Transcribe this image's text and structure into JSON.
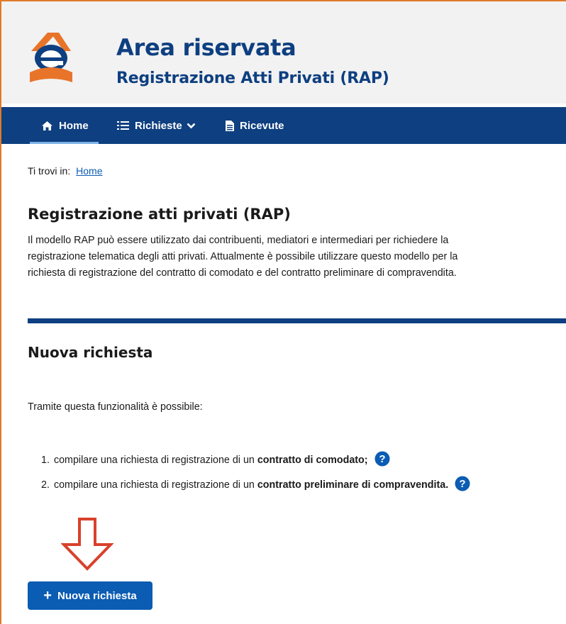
{
  "header": {
    "title": "Area riservata",
    "subtitle": "Registrazione Atti Privati (RAP)"
  },
  "nav": {
    "items": [
      {
        "label": "Home",
        "icon": "home-icon",
        "active": true
      },
      {
        "label": "Richieste",
        "icon": "list-icon",
        "dropdown": true
      },
      {
        "label": "Ricevute",
        "icon": "document-icon"
      }
    ]
  },
  "breadcrumb": {
    "prefix": "Ti trovi in:",
    "link": "Home"
  },
  "page": {
    "title": "Registrazione atti privati (RAP)",
    "intro_lines": [
      "Il modello RAP può essere utilizzato dai contribuenti, mediatori e intermediari per richiedere la",
      "registrazione telematica degli atti privati. Attualmente è possibile utilizzare questo modello per la",
      "richiesta di registrazione del contratto di comodato e del contratto preliminare di compravendita."
    ]
  },
  "section": {
    "title": "Nuova richiesta",
    "lead": "Tramite questa funzionalità è possibile:",
    "items": [
      {
        "number": "1.",
        "text": "compilare una richiesta di registrazione di un",
        "bold": "contratto di comodato;"
      },
      {
        "number": "2.",
        "text": "compilare una richiesta di registrazione di un",
        "bold": "contratto preliminare di compravendita."
      }
    ],
    "button_label": "Nuova richiesta"
  },
  "colors": {
    "brand": "#0e3f80",
    "link": "#0b5cb3",
    "button": "#0b5cb3",
    "logo_orange": "#e8742a",
    "arrow": "#d9412b"
  }
}
